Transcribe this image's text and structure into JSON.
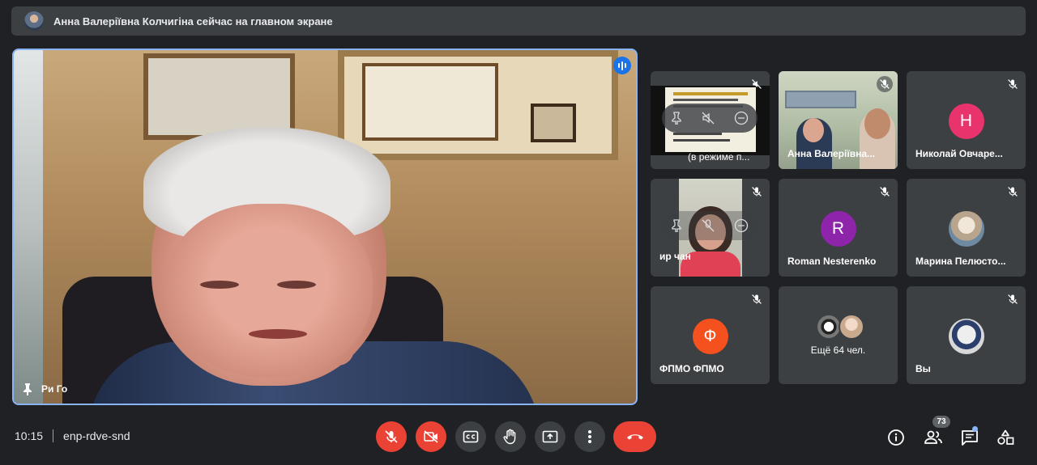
{
  "banner": {
    "text": "Анна Валеріївна Колчигіна сейчас на главном экране",
    "avatar_icon": "user-photo-avatar"
  },
  "main_tile": {
    "name": "Ри Го",
    "pin_icon": "pin-icon",
    "speaking_icon": "audio-levels-icon"
  },
  "tiles": [
    {
      "name": "(в режиме п...",
      "type": "presentation",
      "mute_icon": "volume-off-icon"
    },
    {
      "name": "Анна Валеріївна...",
      "type": "video",
      "mute_icon": "mic-off-icon"
    },
    {
      "name": "Николай Овчаре...",
      "type": "letter",
      "letter": "Н",
      "color": "#e8336d",
      "mute_icon": "mic-off-icon"
    },
    {
      "name": "ир чан",
      "type": "video-small",
      "mute_icon": "mic-off-icon"
    },
    {
      "name": "Roman Nesterenko",
      "type": "letter",
      "letter": "R",
      "color": "#8e24aa",
      "mute_icon": "mic-off-icon"
    },
    {
      "name": "Марина Пелюсто...",
      "type": "photo",
      "mute_icon": "mic-off-icon"
    },
    {
      "name": "ФПМО ФПМО",
      "type": "letter",
      "letter": "Ф",
      "color": "#f4511e",
      "mute_icon": "mic-off-icon"
    },
    {
      "name": "Ещё 64 чел.",
      "type": "more"
    },
    {
      "name": "Вы",
      "type": "photo",
      "mute_icon": "mic-off-icon"
    }
  ],
  "bottom": {
    "time": "10:15",
    "meeting_code": "enp-rdve-snd",
    "participants_count": "73"
  },
  "colors": {
    "background": "#202124",
    "tile": "#3c4043",
    "danger": "#ea4335",
    "active_border": "#8ab4f8"
  }
}
